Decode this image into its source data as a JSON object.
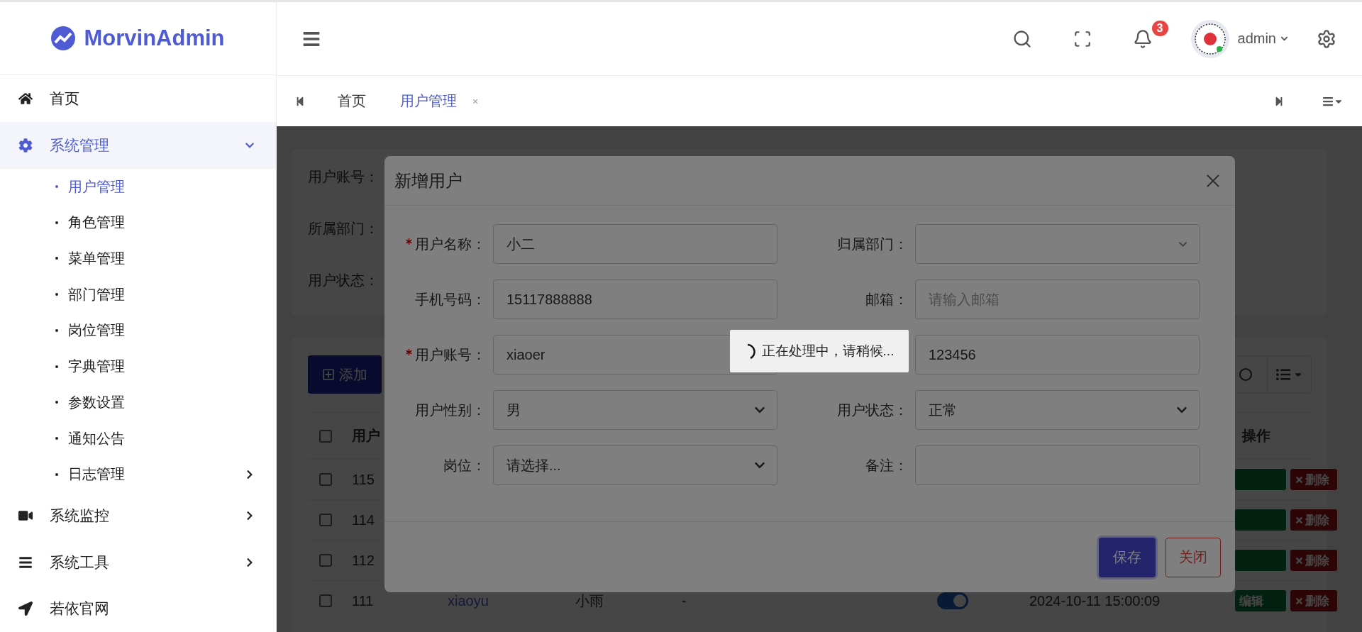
{
  "sidebar": {
    "logo": "MorvinAdmin",
    "items": [
      {
        "label": "首页",
        "selected": false
      },
      {
        "label": "系统管理",
        "selected": true,
        "expanded": true,
        "children": [
          {
            "label": "用户管理",
            "selected": true
          },
          {
            "label": "角色管理",
            "selected": false
          },
          {
            "label": "菜单管理",
            "selected": false
          },
          {
            "label": "部门管理",
            "selected": false
          },
          {
            "label": "岗位管理",
            "selected": false
          },
          {
            "label": "字典管理",
            "selected": false
          },
          {
            "label": "参数设置",
            "selected": false
          },
          {
            "label": "通知公告",
            "selected": false
          },
          {
            "label": "日志管理",
            "selected": false,
            "expanded": false
          }
        ]
      },
      {
        "label": "系统监控",
        "selected": false,
        "expanded": false
      },
      {
        "label": "系统工具",
        "selected": false,
        "expanded": false
      },
      {
        "label": "若依官网",
        "selected": false
      }
    ]
  },
  "header": {
    "notifications": "3",
    "user": "admin"
  },
  "tabs": [
    {
      "label": "首页",
      "selected": false
    },
    {
      "label": "用户管理",
      "selected": true,
      "close": "×"
    }
  ],
  "search_form": {
    "labels": [
      "用户账号：",
      "所属部门：",
      "用户状态："
    ]
  },
  "table": {
    "add_button": "添加",
    "columns": [
      "用户",
      "操作"
    ],
    "all_checked": false,
    "rows": [
      {
        "id": "115",
        "checked": false,
        "actions": [
          {
            "kind": "edit"
          },
          {
            "kind": "delete",
            "label": "删除"
          }
        ]
      },
      {
        "id": "114",
        "checked": false,
        "actions": [
          {
            "kind": "edit"
          },
          {
            "kind": "delete",
            "label": "删除"
          }
        ]
      },
      {
        "id": "112",
        "checked": false,
        "actions": [
          {
            "kind": "edit"
          },
          {
            "kind": "delete",
            "label": "删除"
          }
        ]
      },
      {
        "id": "111",
        "checked": false,
        "username": "xiaoyu",
        "nickname": "小雨",
        "dept": "-",
        "on": true,
        "created": "2024-10-11 15:00:09",
        "actions": [
          {
            "kind": "edit",
            "label": "编辑"
          },
          {
            "kind": "delete",
            "label": "删除"
          }
        ]
      }
    ]
  },
  "modal": {
    "title": "新增用户",
    "fields": [
      {
        "label": "用户名称：",
        "required": true,
        "kind": "text",
        "value": "小二"
      },
      {
        "label": "归属部门：",
        "required": false,
        "kind": "tree"
      },
      {
        "label": "手机号码：",
        "required": false,
        "kind": "text",
        "value": "15117888888"
      },
      {
        "label": "邮箱：",
        "required": false,
        "kind": "text",
        "placeholder": "请输入邮箱"
      },
      {
        "label": "用户账号：",
        "required": true,
        "kind": "text",
        "value": "xiaoer"
      },
      {
        "required": false,
        "kind": "text",
        "value": "123456"
      },
      {
        "label": "用户性别：",
        "required": false,
        "kind": "select",
        "value": "男"
      },
      {
        "label": "用户状态：",
        "required": false,
        "kind": "select",
        "value": "正常"
      },
      {
        "label": "岗位：",
        "required": false,
        "kind": "select",
        "value": "请选择..."
      },
      {
        "label": "备注：",
        "required": false,
        "kind": "text"
      }
    ],
    "buttons": [
      {
        "label": "保存",
        "kind": "primary"
      },
      {
        "label": "关闭",
        "kind": "danger"
      }
    ]
  },
  "loading": {
    "text": "正在处理中，请稍候..."
  }
}
